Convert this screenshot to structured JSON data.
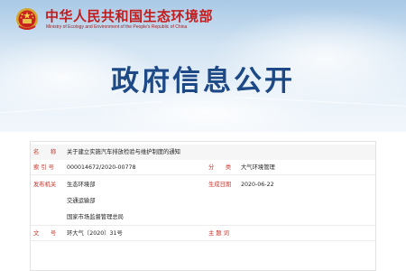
{
  "header": {
    "org_name_cn": "中华人民共和国生态环境部",
    "org_name_en": "Ministry of Ecology and Environment of the People's Republic of China",
    "page_heading": "政府信息公开"
  },
  "document_info": {
    "title_label": "名　　称",
    "title_value": "关于建立实施汽车排放检验与维护制度的通知",
    "index_label": "索 引 号",
    "index_value": "000014672/2020-00778",
    "category_label": "分　　类",
    "category_value": "大气环境管理",
    "issuer_label": "发布机关",
    "issuers": [
      "生态环境部",
      "交通运输部",
      "国家市场监督管理总局"
    ],
    "date_label": "生成日期",
    "date_value": "2020-06-22",
    "doc_no_label": "文　　号",
    "doc_no_value": "环大气〔2020〕31号",
    "keywords_label": "主 题 词",
    "keywords_value": ""
  },
  "colors": {
    "label_red": "#c8352b",
    "heading_blue": "#1d4a86",
    "org_red": "#c21d1d"
  }
}
